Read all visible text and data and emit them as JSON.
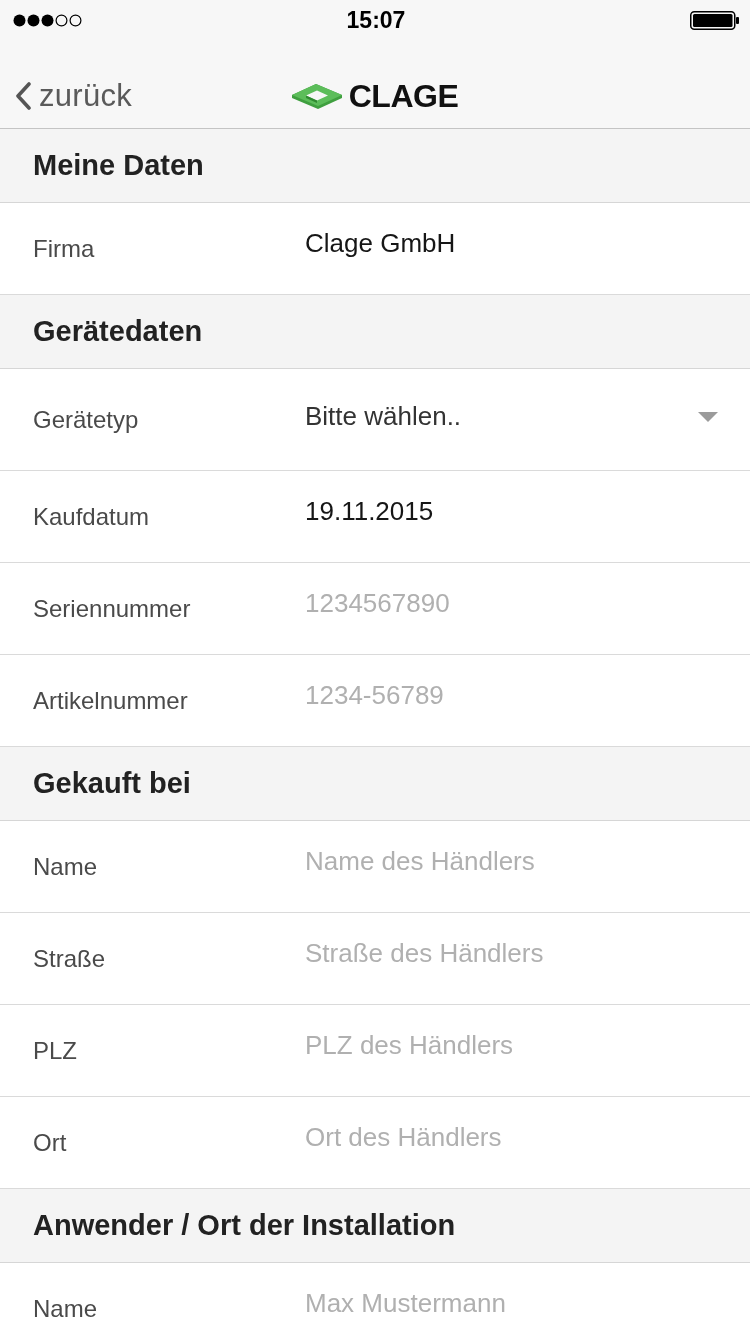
{
  "status_bar": {
    "time": "15:07"
  },
  "nav_bar": {
    "back_label": "zurück",
    "brand": "CLAGE"
  },
  "sections": [
    {
      "title": "Meine Daten",
      "fields": [
        {
          "kind": "text",
          "label": "Firma",
          "value": "Clage GmbH"
        }
      ]
    },
    {
      "title": "Gerätedaten",
      "fields": [
        {
          "kind": "select",
          "label": "Gerätetyp",
          "value": "Bitte wählen.."
        },
        {
          "kind": "date",
          "label": "Kaufdatum",
          "value": "19.11.2015"
        },
        {
          "kind": "text",
          "label": "Seriennummer",
          "placeholder": "1234567890"
        },
        {
          "kind": "text",
          "label": "Artikelnummer",
          "placeholder": "1234-56789"
        }
      ]
    },
    {
      "title": "Gekauft bei",
      "fields": [
        {
          "kind": "text",
          "label": "Name",
          "placeholder": "Name des Händlers"
        },
        {
          "kind": "text",
          "label": "Straße",
          "placeholder": "Straße des Händlers"
        },
        {
          "kind": "text",
          "label": "PLZ",
          "placeholder": "PLZ des Händlers"
        },
        {
          "kind": "text",
          "label": "Ort",
          "placeholder": "Ort des Händlers"
        }
      ]
    },
    {
      "title": "Anwender / Ort der Installation",
      "fields": [
        {
          "kind": "text",
          "label": "Name",
          "placeholder": "Max Mustermann"
        }
      ]
    }
  ]
}
